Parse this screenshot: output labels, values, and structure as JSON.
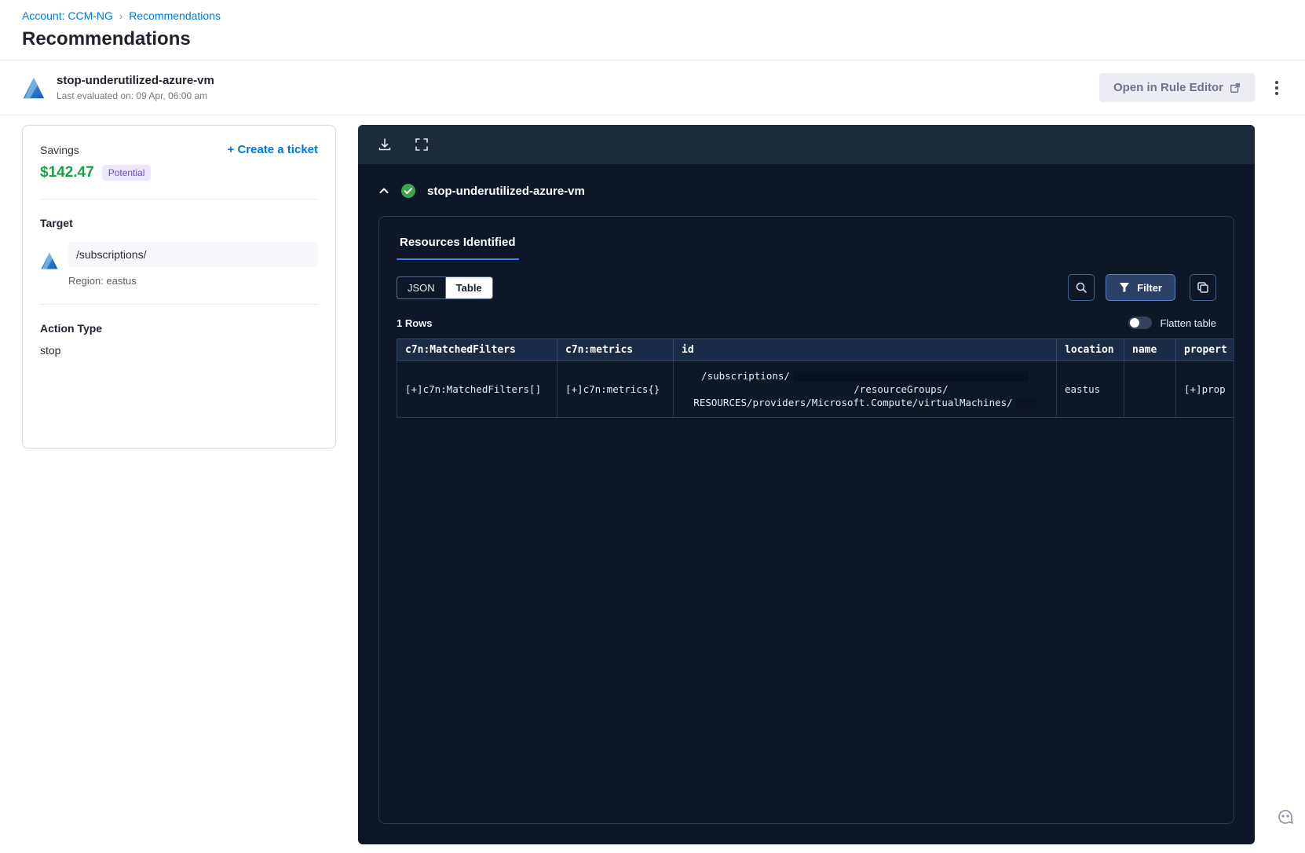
{
  "breadcrumb": {
    "account_link": "Account: CCM-NG",
    "separator": "›",
    "current": "Recommendations"
  },
  "page_title": "Recommendations",
  "header": {
    "title": "stop-underutilized-azure-vm",
    "subtitle": "Last evaluated on: 09 Apr, 06:00 am",
    "open_rule_editor_label": "Open in Rule Editor"
  },
  "summary_card": {
    "savings_label": "Savings",
    "create_ticket_label": "+ Create a ticket",
    "savings_amount": "$142.47",
    "savings_badge": "Potential",
    "target_label": "Target",
    "target_path": "/subscriptions/",
    "target_region": "Region: eastus",
    "action_type_label": "Action Type",
    "action_type_value": "stop"
  },
  "panel": {
    "section_title": "stop-underutilized-azure-vm",
    "tab_label": "Resources Identified",
    "view_toggle": {
      "json": "JSON",
      "table": "Table",
      "selected": "Table"
    },
    "filter_button_label": "Filter",
    "row_count_label": "1 Rows",
    "flatten_toggle_label": "Flatten table",
    "flatten_toggle_state": "off",
    "table": {
      "headers": [
        "c7n:MatchedFilters",
        "c7n:metrics",
        "id",
        "location",
        "name",
        "propert"
      ],
      "rows": [
        {
          "matched_filters": "[+]c7n:MatchedFilters[]",
          "metrics": "[+]c7n:metrics{}",
          "id_line1": "/subscriptions/",
          "id_line2": "/resourceGroups/",
          "id_line3": "RESOURCES/providers/Microsoft.Compute/virtualMachines/",
          "location": "eastus",
          "name": "",
          "properties": "[+]prop"
        }
      ]
    }
  },
  "colors": {
    "accent_blue": "#0278d5",
    "savings_green": "#1e9e45",
    "panel_bg": "#0d1727",
    "check_green": "#3ba747",
    "tab_underline": "#3b82f6"
  }
}
